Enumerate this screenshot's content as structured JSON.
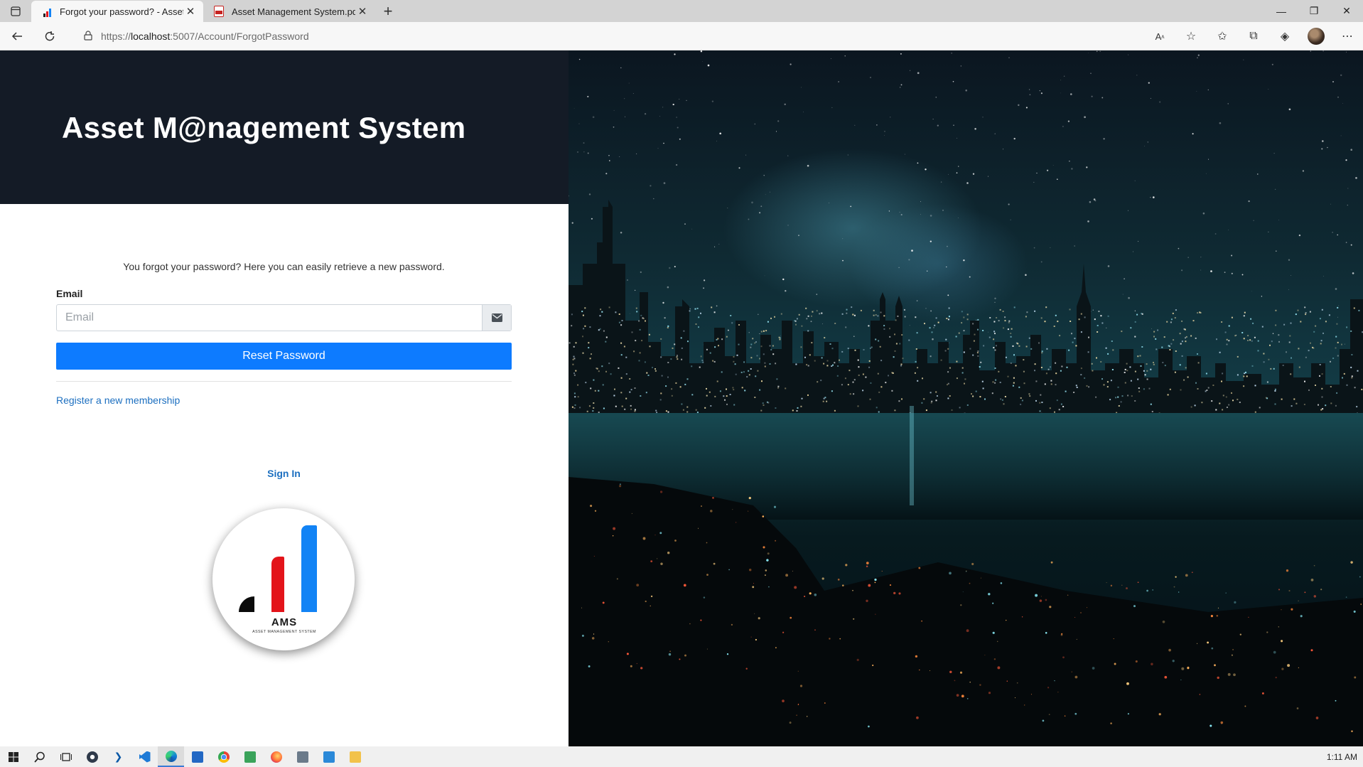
{
  "browser": {
    "tabs": [
      {
        "title": "Forgot your password? - Asset M",
        "active": true
      },
      {
        "title": "Asset Management System.pdf",
        "active": false
      }
    ],
    "url": {
      "scheme": "https://",
      "host": "localhost",
      "rest": ":5007/Account/ForgotPassword"
    }
  },
  "page": {
    "brand_title": "Asset M@nagement System",
    "lead_text": "You forgot your password? Here you can easily retrieve a new password.",
    "email_label": "Email",
    "email_placeholder": "Email",
    "email_value": "",
    "reset_button": "Reset Password",
    "register_link": "Register a new membership",
    "signin_link": "Sign In",
    "logo": {
      "acronym": "AMS",
      "subtitle": "ASSET MANAGEMENT SYSTEM"
    }
  },
  "colors": {
    "brand_bar": "#141b26",
    "primary": "#0d7bff",
    "link": "#1c6fc0",
    "logo_red": "#e3141a",
    "logo_blue": "#1283f5"
  },
  "taskbar": {
    "items": [
      "start-icon",
      "search-icon",
      "task-view-icon",
      "settings-icon",
      "terminal-icon",
      "vscode-icon",
      "edge-icon",
      "remote-desktop-icon",
      "chrome-icon",
      "notepad-icon",
      "firefox-icon",
      "app-icon",
      "store-icon",
      "file-explorer-icon"
    ],
    "clock": "1:11 AM"
  }
}
